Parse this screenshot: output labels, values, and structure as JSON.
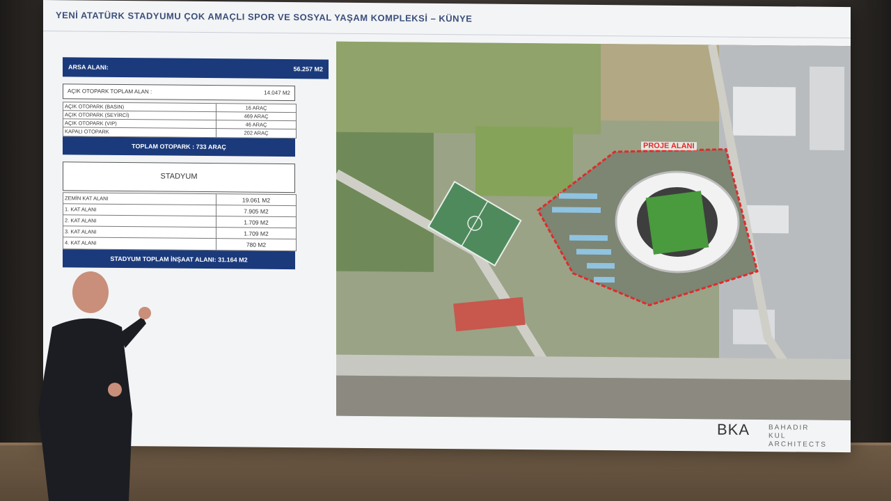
{
  "slide": {
    "title": "YENİ ATATÜRK STADYUMU ÇOK AMAÇLI SPOR VE SOSYAL YAŞAM KOMPLEKSİ – KÜNYE",
    "arsa": {
      "label": "ARSA ALANI:",
      "value": "56.257 M2"
    },
    "otopark": {
      "header_label": "AÇIK OTOPARK TOPLAM ALAN :",
      "header_value": "14.047 M2",
      "rows": [
        {
          "label": "AÇIK OTOPARK (BASIN)",
          "value": "16 ARAÇ"
        },
        {
          "label": "AÇIK OTOPARK (SEYİRCİ)",
          "value": "469 ARAÇ"
        },
        {
          "label": "AÇIK OTOPARK (VIP)",
          "value": "46 ARAÇ"
        },
        {
          "label": "KAPALI OTOPARK",
          "value": "202 ARAÇ"
        }
      ],
      "total": "TOPLAM OTOPARK : 733 ARAÇ"
    },
    "stadyum": {
      "header": "STADYUM",
      "rows": [
        {
          "label": "ZEMİN KAT ALANI",
          "value": "19.061 M2"
        },
        {
          "label": "1. KAT ALANI",
          "value": "7.905 M2"
        },
        {
          "label": "2. KAT ALANI",
          "value": "1.709 M2"
        },
        {
          "label": "3. KAT ALANI",
          "value": "1.709 M2"
        },
        {
          "label": "4. KAT ALANI",
          "value": "780 M2"
        }
      ],
      "total": "STADYUM TOPLAM İNŞAAT ALANI: 31.164 M2"
    },
    "map_label": "PROJE ALANI",
    "logo": {
      "mark": "BKA",
      "line1": "BAHADIR KUL",
      "line2": "ARCHITECTS"
    }
  },
  "colors": {
    "navy": "#1a3a7c",
    "project_outline": "#e02a2a",
    "title": "#3b4f7a"
  }
}
